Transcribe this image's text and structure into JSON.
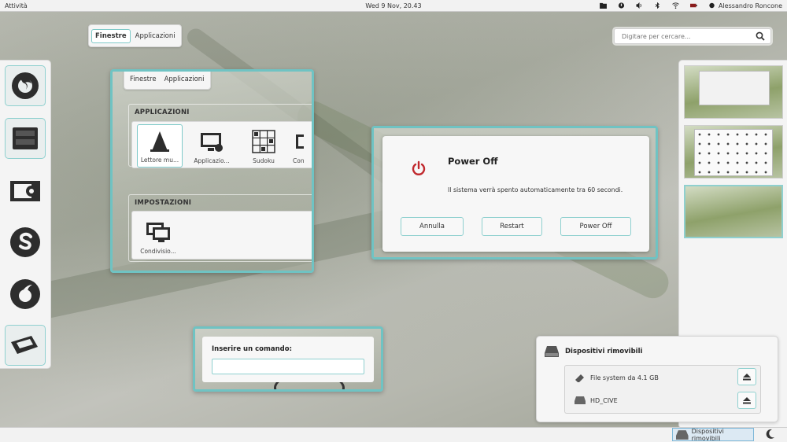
{
  "topbar": {
    "activities": "Attività",
    "clock": "Wed  9 Nov, 20.43",
    "user": "Alessandro Roncone",
    "tray_icons": [
      "folder-icon",
      "power-status-icon",
      "volume-icon",
      "bluetooth-icon",
      "wifi-icon",
      "battery-icon"
    ]
  },
  "overview_tabs": {
    "windows": "Finestre",
    "applications": "Applicazioni"
  },
  "search": {
    "placeholder": "Digitare per cercare..."
  },
  "dash": {
    "apps": [
      "firefox-icon",
      "window-manager-icon",
      "image-viewer-icon",
      "skype-icon",
      "vodafone-icon",
      "tags-icon"
    ]
  },
  "app_window": {
    "tabs": {
      "windows": "Finestre",
      "applications": "Applicazioni"
    },
    "applications_header": "APPLICAZIONI",
    "applications": [
      {
        "label": "Lettore mu...",
        "icon": "vlc-icon"
      },
      {
        "label": "Applicazio...",
        "icon": "monitor-settings-icon"
      },
      {
        "label": "Sudoku",
        "icon": "sudoku-icon"
      },
      {
        "label": "Con",
        "icon": "connections-icon"
      }
    ],
    "settings_header": "IMPOSTAZIONI",
    "settings": [
      {
        "label": "Condivisio...",
        "icon": "sharing-icon"
      }
    ]
  },
  "power_dialog": {
    "title": "Power Off",
    "message": "Il sistema verrà spento automaticamente tra 60 secondi.",
    "cancel": "Annulla",
    "restart": "Restart",
    "power_off": "Power Off",
    "accent": "#c0282d"
  },
  "run_dialog": {
    "label": "Inserire un comando:",
    "value": ""
  },
  "devices": {
    "title": "Dispositivi rimovibili",
    "items": [
      {
        "name": "File system da 4.1 GB",
        "icon": "usb-key-icon"
      },
      {
        "name": "HD_CIVE",
        "icon": "hard-drive-icon"
      }
    ]
  },
  "bottombar": {
    "notification": "Dispositivi rimovibili"
  },
  "colors": {
    "highlight": "#6fc3c3",
    "panel": "#f4f4f4"
  }
}
